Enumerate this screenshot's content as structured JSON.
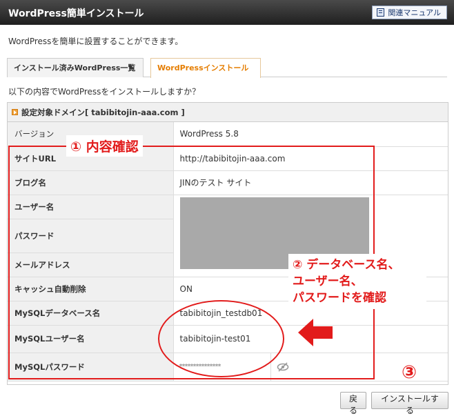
{
  "header": {
    "title": "WordPress簡単インストール",
    "manual_label": "関連マニュアル"
  },
  "intro_text": "WordPressを簡単に設置することができます。",
  "tabs": [
    {
      "label": "インストール済みWordPress一覧",
      "active": false
    },
    {
      "label": "WordPressインストール",
      "active": true
    }
  ],
  "confirm_text": "以下の内容でWordPressをインストールしますか？",
  "panel": {
    "heading": "設定対象ドメイン[ tabibitojin-aaa.com ]"
  },
  "rows": [
    {
      "label": "バージョン",
      "value": "WordPress 5.8"
    },
    {
      "label": "サイトURL",
      "value": "http://tabibitojin-aaa.com"
    },
    {
      "label": "ブログ名",
      "value": "JINのテスト サイト"
    },
    {
      "label": "ユーザー名",
      "value": ""
    },
    {
      "label": "パスワード",
      "value": ""
    },
    {
      "label": "メールアドレス",
      "value": ""
    },
    {
      "label": "キャッシュ自動削除",
      "value": "ON"
    },
    {
      "label": "MySQLデータベース名",
      "value": "tabibitojin_testdb01"
    },
    {
      "label": "MySQLユーザー名",
      "value": "tabibitojin-test01"
    },
    {
      "label": "MySQLパスワード",
      "value": "***************"
    }
  ],
  "buttons": {
    "back": "戻る",
    "install": "インストールする"
  },
  "annotations": {
    "note1": "① 内容確認",
    "note2_lines": [
      "② データベース名、",
      "ユーザー名、",
      "パスワードを確認"
    ],
    "note3": "③"
  },
  "colors": {
    "annotation_red": "#e21b1b",
    "active_tab": "#e57d00",
    "mask_gray": "#a9a9a9"
  },
  "icons": {
    "manual": "book-icon",
    "heading": "arrow-right-icon",
    "password_toggle": "eye-slash-icon"
  }
}
